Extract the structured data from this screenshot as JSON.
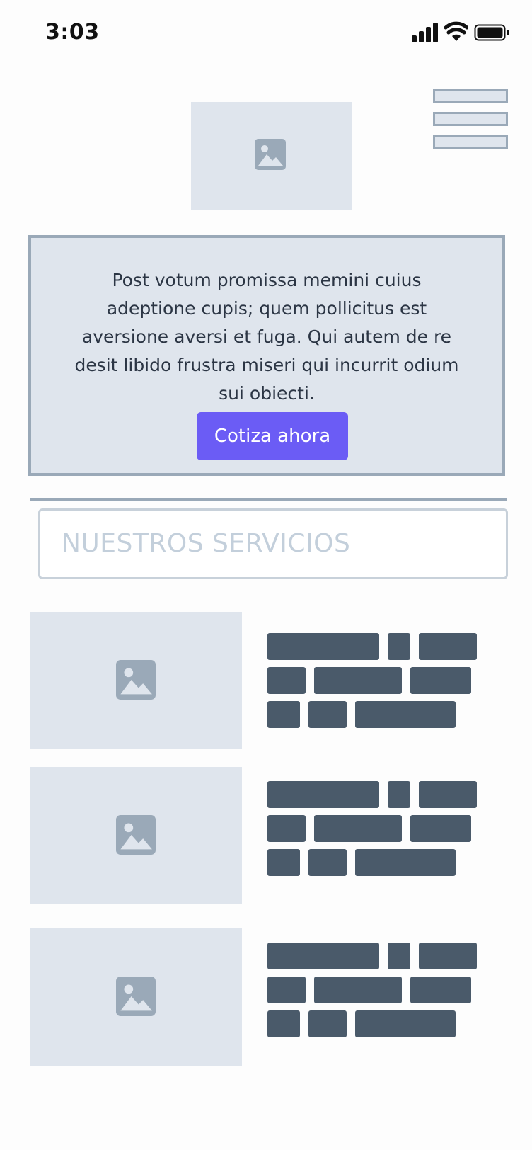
{
  "status_bar": {
    "time": "3:03",
    "icons": [
      "signal-icon",
      "wifi-icon",
      "battery-icon"
    ]
  },
  "header": {
    "logo_icon": "image-icon",
    "menu_icon": "hamburger-menu-icon"
  },
  "hero": {
    "text": "Post votum promissa memini cuius adeptione cupis; quem pollicitus est aversione aversi et fuga. Qui autem de re desit libido frustra miseri qui incurrit odium sui obiecti.",
    "cta_label": "Cotiza ahora"
  },
  "services": {
    "title": "NUESTROS SERVICIOS",
    "items": [
      {
        "image_icon": "image-icon"
      },
      {
        "image_icon": "image-icon"
      },
      {
        "image_icon": "image-icon"
      }
    ]
  },
  "colors": {
    "accent": "#6b5cf5",
    "placeholder_bg": "#dfe5ed",
    "border": "#9aa9b8",
    "text_block": "#4a5a6a"
  }
}
